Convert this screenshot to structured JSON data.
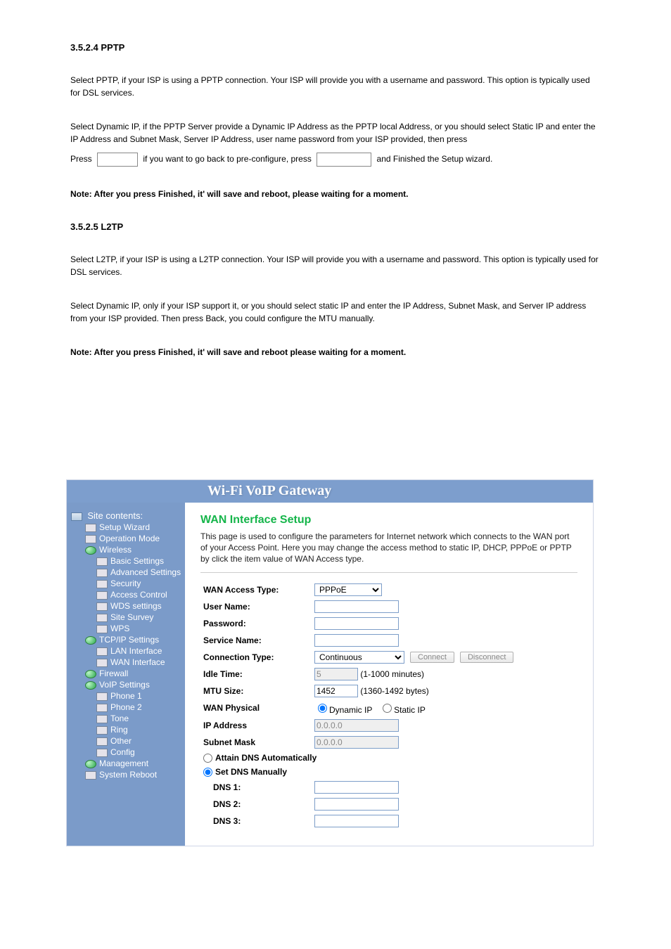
{
  "upper": {
    "section_num": "3.5.2.4 PPTP",
    "p1": "Select PPTP, if your ISP is using a PPTP connection. Your ISP will provide you with a username and password. This option is typically used for DSL services.",
    "p2_prefix": "Select Dynamic IP, if the PPTP Server provide a Dynamic IP Address as the PPTP local Address, or you should select Static IP and enter the IP Address and Subnet Mask, Server IP Address, user name password from your ISP provided, then press",
    "p2_suffix": "",
    "finish_label": "Finished",
    "p3": "Note: After you press Finished, it' will save and reboot, please waiting for a moment.",
    "p4_num": "3.5.2.5 L2TP",
    "p4": "Select L2TP, if your ISP is using a L2TP connection. Your ISP will provide you with a username and password. This option is typically used for DSL services.",
    "p5": "Select Dynamic IP, only if your ISP support it, or you should select static IP and enter the IP Address, Subnet Mask, and Server IP address from your ISP provided. Then press Back, you could configure the MTU manually.",
    "btn_note_prefix": "Press",
    "btn_note_back": "if you want to go back to pre-configure, press",
    "btn_note_end": "and Finished the Setup wizard.",
    "p6": "Note: After you press Finished, it' will save and reboot please waiting for a moment."
  },
  "banner": "Wi-Fi  VoIP  Gateway",
  "sidebar": {
    "title": "Site contents:",
    "items": [
      {
        "icon": "pc",
        "label": "",
        "indent": 0,
        "title": true
      },
      {
        "icon": "page",
        "label": "Setup Wizard",
        "indent": 1
      },
      {
        "icon": "page",
        "label": "Operation Mode",
        "indent": 1
      },
      {
        "icon": "globe",
        "label": "Wireless",
        "indent": 1
      },
      {
        "icon": "page",
        "label": "Basic Settings",
        "indent": 2
      },
      {
        "icon": "page",
        "label": "Advanced Settings",
        "indent": 2
      },
      {
        "icon": "page",
        "label": "Security",
        "indent": 2
      },
      {
        "icon": "page",
        "label": "Access Control",
        "indent": 2
      },
      {
        "icon": "page",
        "label": "WDS settings",
        "indent": 2
      },
      {
        "icon": "page",
        "label": "Site Survey",
        "indent": 2
      },
      {
        "icon": "page",
        "label": "WPS",
        "indent": 2
      },
      {
        "icon": "globe",
        "label": "TCP/IP Settings",
        "indent": 1
      },
      {
        "icon": "page",
        "label": "LAN Interface",
        "indent": 2
      },
      {
        "icon": "page",
        "label": "WAN Interface",
        "indent": 2
      },
      {
        "icon": "globe",
        "label": "Firewall",
        "indent": 1
      },
      {
        "icon": "globe",
        "label": "VoIP Settings",
        "indent": 1
      },
      {
        "icon": "page",
        "label": "Phone 1",
        "indent": 2
      },
      {
        "icon": "page",
        "label": "Phone 2",
        "indent": 2
      },
      {
        "icon": "page",
        "label": "Tone",
        "indent": 2
      },
      {
        "icon": "page",
        "label": "Ring",
        "indent": 2
      },
      {
        "icon": "page",
        "label": "Other",
        "indent": 2
      },
      {
        "icon": "page",
        "label": "Config",
        "indent": 2
      },
      {
        "icon": "globe",
        "label": "Management",
        "indent": 1
      },
      {
        "icon": "page",
        "label": "System Reboot",
        "indent": 1
      }
    ]
  },
  "content": {
    "title": "WAN Interface Setup",
    "desc": "This page is used to configure the parameters for Internet network which connects to the WAN port of your Access Point. Here you may change the access method to static IP, DHCP, PPPoE or PPTP by click the item value of WAN Access type.",
    "labels": {
      "wan_access_type": "WAN Access Type:",
      "user_name": "User Name:",
      "password": "Password:",
      "service_name": "Service Name:",
      "connection_type": "Connection Type:",
      "idle_time": "Idle Time:",
      "mtu_size": "MTU Size:",
      "wan_physical": "WAN Physical",
      "ip_address": "IP Address",
      "subnet_mask": "Subnet Mask",
      "attain_dns": "Attain DNS Automatically",
      "set_dns": "Set DNS Manually",
      "dns1": "DNS 1:",
      "dns2": "DNS 2:",
      "dns3": "DNS 3:"
    },
    "values": {
      "wan_access_type": "PPPoE",
      "connection_type": "Continuous",
      "idle_time": "5",
      "idle_time_note": "(1-1000 minutes)",
      "mtu_size": "1452",
      "mtu_note": "(1360-1492 bytes)",
      "dyn_ip_label": "Dynamic IP",
      "static_ip_label": "Static IP",
      "ip_address": "0.0.0.0",
      "subnet_mask": "0.0.0.0",
      "connect_btn": "Connect",
      "disconnect_btn": "Disconnect"
    }
  }
}
